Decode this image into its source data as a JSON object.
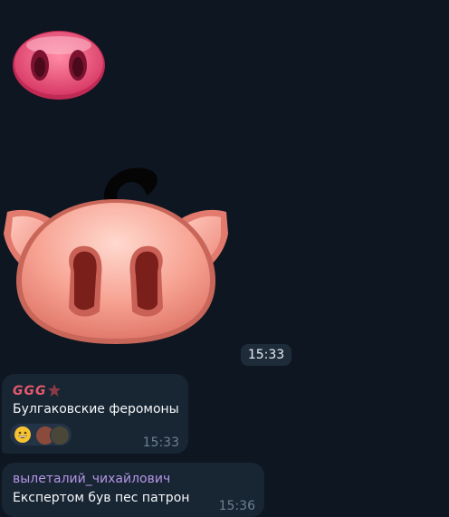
{
  "colors": {
    "background": "#0e1621",
    "bubble": "#182533",
    "accent_sender1": "#e55a6d",
    "accent_sender2": "#b495e6",
    "time_text": "#6d7f8f"
  },
  "stickers": [
    {
      "name": "pig-snout-sticker"
    },
    {
      "name": "pig-face-sticker"
    }
  ],
  "sticker_time": "15:33",
  "messages": [
    {
      "sender": "GGG",
      "badge_icon": "star-icon",
      "text": "Булгаковские феромоны",
      "time": "15:33",
      "reaction": {
        "emoji": "grinning-face-icon",
        "avatars": 2
      }
    },
    {
      "sender": "вылеталий_чихайлович",
      "text": "Експертом був пес патрон",
      "time": "15:36"
    }
  ]
}
